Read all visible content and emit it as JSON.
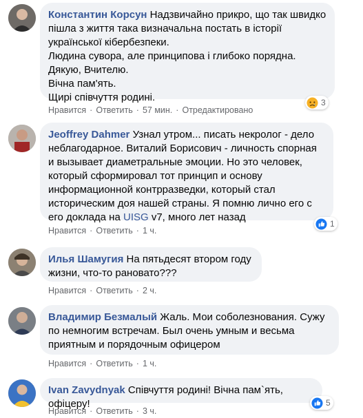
{
  "comments": [
    {
      "author": "Константин Корсун",
      "text": "Надзвичайно прикро, що так швидко пішла з життя така визначальна постать в історії української кібербезпеки.\nЛюдина сувора, але принципова і глибоко порядна.\nДякую, Вчителю.\nВічна пам'ять.\nЩирі співчуття родині.",
      "like": "Нравится",
      "reply": "Ответить",
      "time": "57 мин.",
      "edited": "Отредактировано",
      "reaction": {
        "icon": "sad-emoji-icon",
        "count": "3"
      }
    },
    {
      "author": "Jeoffrey Dahmer",
      "text_before": "Узнал утром... писать некролог - дело неблагодарное. Виталий Борисович - личность спорная и вызывает диаметральные эмоции. Но это человек, который сформировал тот принцип и основу информационной контрразведки, который стал историческим доя нашей страны. Я помню лично его с его доклада на ",
      "link": "UISG",
      "text_after": " v7, много лет назад",
      "like": "Нравится",
      "reply": "Ответить",
      "time": "1 ч.",
      "reaction": {
        "icon": "like-icon",
        "count": "1"
      }
    },
    {
      "author": "Илья Шамугия",
      "text": "На пятьдесят втором году жизни, что-то рановато???",
      "like": "Нравится",
      "reply": "Ответить",
      "time": "2 ч."
    },
    {
      "author": "Владимир Безмалый",
      "text": "Жаль. Мои соболезнования. Сужу по немногим встречам. Был очень умным и весьма приятным и порядочным офицером",
      "like": "Нравится",
      "reply": "Ответить",
      "time": "1 ч."
    },
    {
      "author": "Ivan Zavydnyak",
      "text": "Співчуття родині! Вічна пам`ять, офіцеру!",
      "like": "Нравится",
      "reply": "Ответить",
      "time": "3 ч.",
      "reaction": {
        "icon": "like-icon",
        "count": "5"
      }
    }
  ],
  "separator": "·",
  "colors": {
    "link": "#385898",
    "bubble": "#f0f2f5",
    "meta": "#65676b",
    "like_blue": "#1877f2",
    "sad_yellow": "#f7b125"
  }
}
